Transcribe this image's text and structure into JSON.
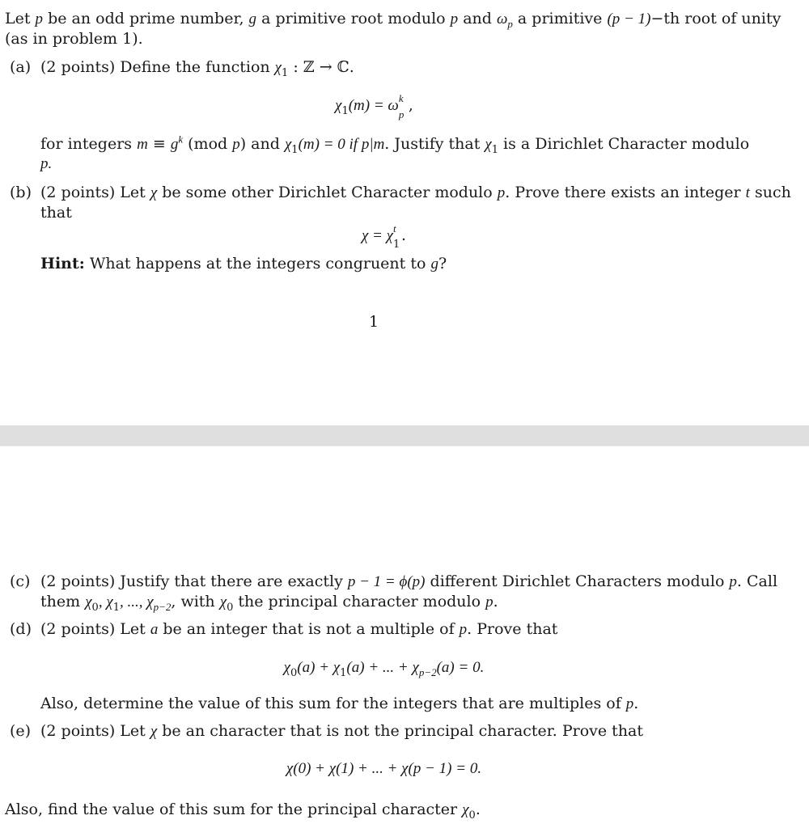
{
  "page1": {
    "intro": {
      "line1_parts": [
        "Let ",
        "p",
        " be an odd prime number, ",
        "g",
        " a primitive root modulo ",
        "p",
        " and ",
        "ω",
        "p",
        " a primitive ",
        "(p − 1)",
        "−th root of unity"
      ],
      "line2": "(as in problem 1)."
    },
    "part_a": {
      "label": "(a)",
      "points": "(2 points)",
      "text_before": "Define the function ",
      "func": "χ",
      "func_sub": "1",
      "func_sig": " : ℤ → ℂ.",
      "eq_lhs": "χ",
      "eq_lhs_sub": "1",
      "eq_lhs_arg": "(m) = ω",
      "eq_sup": "k",
      "eq_sub": "p",
      "eq_end": ",",
      "body_line1_a": "for integers ",
      "body_m": "m",
      "body_equiv": " ≡ ",
      "body_g": "g",
      "body_k": "k",
      "body_mod": " (mod ",
      "body_p": "p",
      "body_line1_b": ") and ",
      "body_chi": "χ",
      "body_chi_sub": "1",
      "body_arg": "(m) = 0 if ",
      "body_div": "p|m",
      "body_line1_c": ". Justify that ",
      "body_line1_d": " is a Dirichlet Character modulo",
      "body_line2": "p."
    },
    "part_b": {
      "label": "(b)",
      "points": "(2 points)",
      "line1_a": "Let ",
      "chi": "χ",
      "line1_b": " be some other Dirichlet Character modulo ",
      "p": "p",
      "line1_c": ". Prove there exists an integer ",
      "t": "t",
      "line1_d": " such",
      "line2": "that",
      "eq_lhs": "χ = χ",
      "eq_sup": "t",
      "eq_sub": "1",
      "eq_end": ".",
      "hint_label": "Hint:",
      "hint_text": " What happens at the integers congruent to ",
      "hint_g": "g",
      "hint_end": "?"
    },
    "page_number": "1"
  },
  "page2": {
    "part_c": {
      "label": "(c)",
      "points": "(2 points)",
      "line1_a": "Justify that there are exactly ",
      "line1_math": "p − 1 = ϕ(p)",
      "line1_b": " different Dirichlet Characters modulo ",
      "p": "p",
      "line1_c": ". Call",
      "line2_a": "them ",
      "line2_math": [
        "χ",
        "0",
        ", χ",
        "1",
        ", ..., χ",
        "p−2"
      ],
      "line2_b": ", with ",
      "line2_chi0": [
        "χ",
        "0"
      ],
      "line2_c": " the principal character modulo ",
      "line2_end": "."
    },
    "part_d": {
      "label": "(d)",
      "points": "(2 points)",
      "line1_a": "Let ",
      "a": "a",
      "line1_b": " be an integer that is not a multiple of ",
      "p": "p",
      "line1_c": ". Prove that",
      "equation": [
        "χ",
        "0",
        "(a) + χ",
        "1",
        "(a) + ... + χ",
        "p−2",
        "(a) = 0."
      ],
      "also": "Also, determine the value of this sum for the integers that are multiples of ",
      "also_end": "."
    },
    "part_e": {
      "label": "(e)",
      "points": "(2 points)",
      "line1_a": "Let ",
      "chi": "χ",
      "line1_b": " be an character that is not the principal character. Prove that",
      "equation": "χ(0) + χ(1) + ... + χ(p − 1) = 0.",
      "also": "Also, find the value of this sum for the principal character ",
      "also_chi": "χ",
      "also_sub": "0",
      "also_end": "."
    }
  }
}
